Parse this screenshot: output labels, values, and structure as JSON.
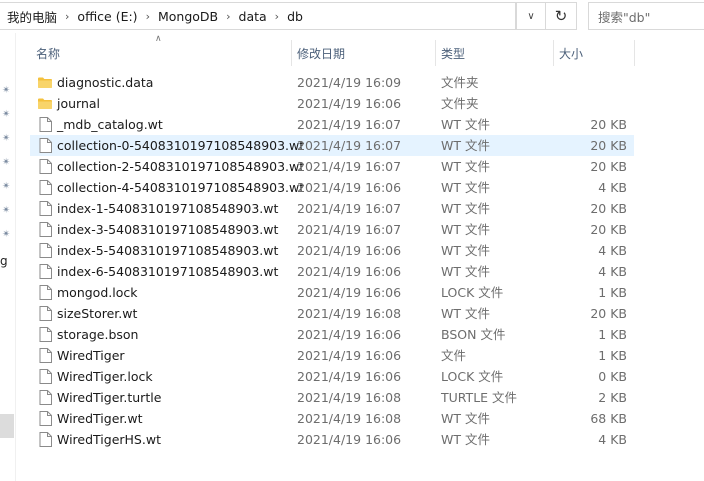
{
  "breadcrumb": [
    "我的电脑",
    "office (E:)",
    "MongoDB",
    "data",
    "db"
  ],
  "search": {
    "placeholder": "搜索\"db\""
  },
  "nav": {
    "partial_label": "g"
  },
  "columns": {
    "name": "名称",
    "date": "修改日期",
    "type": "类型",
    "size": "大小"
  },
  "icons": {
    "folder": "folder-icon",
    "file": "file-icon",
    "refresh": "refresh-icon",
    "dropdown": "chevron-down-icon",
    "pin": "pin-icon"
  },
  "colors": {
    "folder": "#f4c13d",
    "selected_row": "#e5f3ff",
    "header_text": "#4c607a"
  },
  "files": [
    {
      "name": "diagnostic.data",
      "date": "2021/4/19 16:09",
      "type": "文件夹",
      "size": "",
      "kind": "folder"
    },
    {
      "name": "journal",
      "date": "2021/4/19 16:06",
      "type": "文件夹",
      "size": "",
      "kind": "folder"
    },
    {
      "name": "_mdb_catalog.wt",
      "date": "2021/4/19 16:07",
      "type": "WT 文件",
      "size": "20 KB",
      "kind": "file"
    },
    {
      "name": "collection-0-5408310197108548903.wt",
      "date": "2021/4/19 16:07",
      "type": "WT 文件",
      "size": "20 KB",
      "kind": "file",
      "selected": true
    },
    {
      "name": "collection-2-5408310197108548903.wt",
      "date": "2021/4/19 16:07",
      "type": "WT 文件",
      "size": "20 KB",
      "kind": "file"
    },
    {
      "name": "collection-4-5408310197108548903.wt",
      "date": "2021/4/19 16:06",
      "type": "WT 文件",
      "size": "4 KB",
      "kind": "file"
    },
    {
      "name": "index-1-5408310197108548903.wt",
      "date": "2021/4/19 16:07",
      "type": "WT 文件",
      "size": "20 KB",
      "kind": "file"
    },
    {
      "name": "index-3-5408310197108548903.wt",
      "date": "2021/4/19 16:07",
      "type": "WT 文件",
      "size": "20 KB",
      "kind": "file"
    },
    {
      "name": "index-5-5408310197108548903.wt",
      "date": "2021/4/19 16:06",
      "type": "WT 文件",
      "size": "4 KB",
      "kind": "file"
    },
    {
      "name": "index-6-5408310197108548903.wt",
      "date": "2021/4/19 16:06",
      "type": "WT 文件",
      "size": "4 KB",
      "kind": "file"
    },
    {
      "name": "mongod.lock",
      "date": "2021/4/19 16:06",
      "type": "LOCK 文件",
      "size": "1 KB",
      "kind": "file"
    },
    {
      "name": "sizeStorer.wt",
      "date": "2021/4/19 16:08",
      "type": "WT 文件",
      "size": "20 KB",
      "kind": "file"
    },
    {
      "name": "storage.bson",
      "date": "2021/4/19 16:06",
      "type": "BSON 文件",
      "size": "1 KB",
      "kind": "file"
    },
    {
      "name": "WiredTiger",
      "date": "2021/4/19 16:06",
      "type": "文件",
      "size": "1 KB",
      "kind": "file"
    },
    {
      "name": "WiredTiger.lock",
      "date": "2021/4/19 16:06",
      "type": "LOCK 文件",
      "size": "0 KB",
      "kind": "file"
    },
    {
      "name": "WiredTiger.turtle",
      "date": "2021/4/19 16:08",
      "type": "TURTLE 文件",
      "size": "2 KB",
      "kind": "file"
    },
    {
      "name": "WiredTiger.wt",
      "date": "2021/4/19 16:08",
      "type": "WT 文件",
      "size": "68 KB",
      "kind": "file"
    },
    {
      "name": "WiredTigerHS.wt",
      "date": "2021/4/19 16:06",
      "type": "WT 文件",
      "size": "4 KB",
      "kind": "file"
    }
  ]
}
